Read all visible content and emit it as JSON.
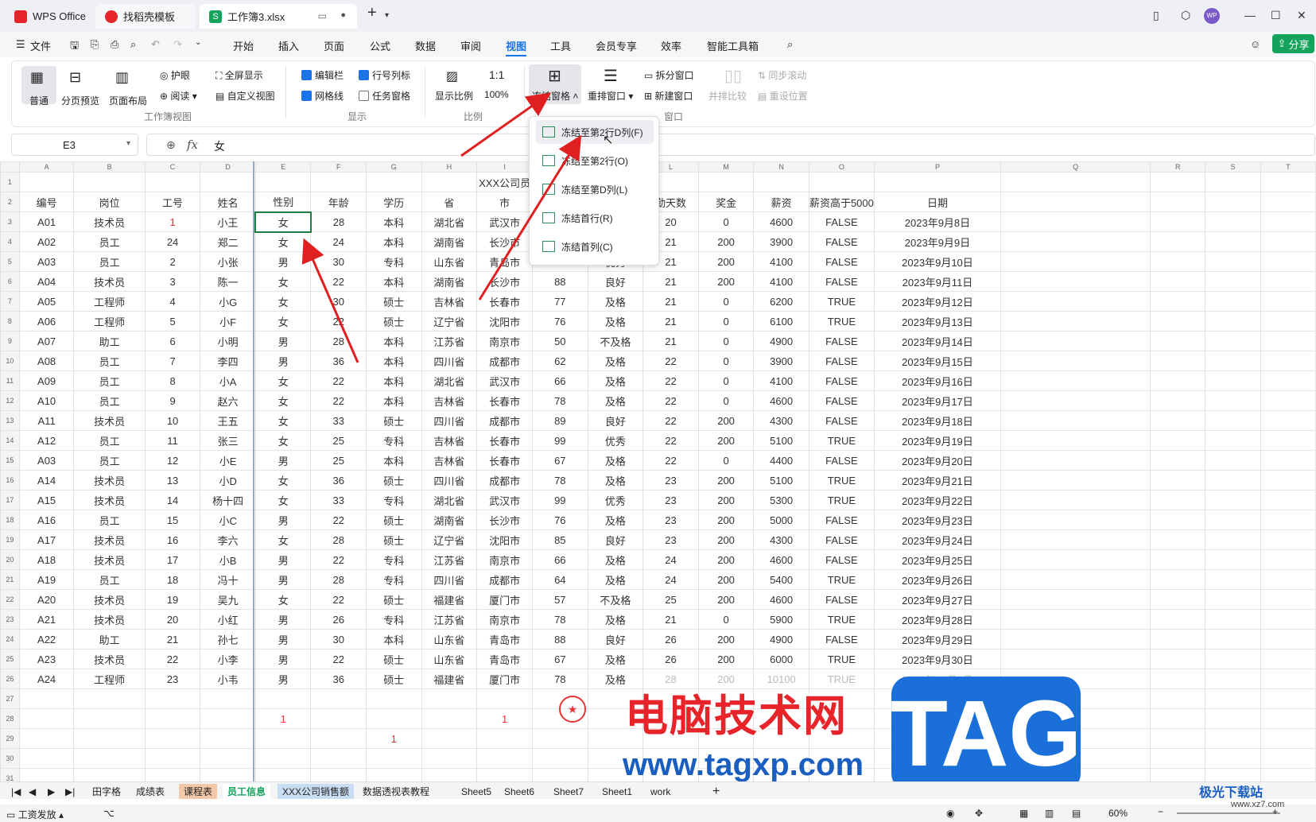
{
  "tabs": [
    {
      "label": "WPS Office"
    },
    {
      "label": "找稻壳模板"
    },
    {
      "label": "工作簿3.xlsx"
    }
  ],
  "menu": {
    "file": "文件",
    "items": [
      "开始",
      "插入",
      "页面",
      "公式",
      "数据",
      "审阅",
      "视图",
      "工具",
      "会员专享",
      "效率",
      "智能工具箱"
    ],
    "active": "视图",
    "share": "分享"
  },
  "ribbon": {
    "normal": "普通",
    "page_break": "分页预览",
    "page_layout": "页面布局",
    "eye": "护眼",
    "read": "阅读",
    "fullscreen": "全屏显示",
    "custom_view": "自定义视图",
    "edit_bar": "编辑栏",
    "row_col": "行号列标",
    "gridlines": "网格线",
    "task_pane": "任务窗格",
    "zoom_ratio": "显示比例",
    "zoom100": "100%",
    "freeze": "冻结窗格",
    "rearrange": "重排窗口",
    "split": "拆分窗口",
    "new_window": "新建窗口",
    "side_by_side": "并排比较",
    "sync_scroll": "同步滚动",
    "reset_pos": "重设位置",
    "grp_view": "工作簿视图",
    "grp_show": "显示",
    "grp_ratio": "比例",
    "grp_window": "窗口"
  },
  "checkboxes": {
    "edit_bar": true,
    "row_col": true,
    "gridlines": true,
    "task_pane": false
  },
  "namebox": "E3",
  "formula": "女",
  "freeze_menu": [
    "冻结至第2行D列(F)",
    "冻结至第2行(O)",
    "冻结至第D列(L)",
    "冻结首行(R)",
    "冻结首列(C)"
  ],
  "sheet": {
    "title": "XXX公司员",
    "col_letters": [
      "A",
      "B",
      "C",
      "D",
      "E",
      "F",
      "G",
      "H",
      "I",
      "J",
      "K",
      "L",
      "M",
      "N",
      "O",
      "P",
      "Q",
      "R",
      "S",
      "T"
    ],
    "headers": [
      "编号",
      "岗位",
      "工号",
      "姓名",
      "性别",
      "年龄",
      "学历",
      "省",
      "市",
      "",
      "",
      "勤天数",
      "奖金",
      "薪资",
      "薪资高于5000",
      "日期"
    ],
    "rows": [
      [
        "A01",
        "技术员",
        "1",
        "小王",
        "女",
        "28",
        "本科",
        "湖北省",
        "武汉市",
        "",
        "",
        "20",
        "0",
        "4600",
        "FALSE",
        "2023年9月8日"
      ],
      [
        "A02",
        "员工",
        "24",
        "郑二",
        "女",
        "24",
        "本科",
        "湖南省",
        "长沙市",
        "",
        "",
        "21",
        "200",
        "3900",
        "FALSE",
        "2023年9月9日"
      ],
      [
        "A03",
        "员工",
        "2",
        "小张",
        "男",
        "30",
        "专科",
        "山东省",
        "青岛市",
        "90",
        "优秀",
        "21",
        "200",
        "4100",
        "FALSE",
        "2023年9月10日"
      ],
      [
        "A04",
        "技术员",
        "3",
        "陈一",
        "女",
        "22",
        "本科",
        "湖南省",
        "长沙市",
        "88",
        "良好",
        "21",
        "200",
        "4100",
        "FALSE",
        "2023年9月11日"
      ],
      [
        "A05",
        "工程师",
        "4",
        "小G",
        "女",
        "30",
        "硕士",
        "吉林省",
        "长春市",
        "77",
        "及格",
        "21",
        "0",
        "6200",
        "TRUE",
        "2023年9月12日"
      ],
      [
        "A06",
        "工程师",
        "5",
        "小F",
        "女",
        "22",
        "硕士",
        "辽宁省",
        "沈阳市",
        "76",
        "及格",
        "21",
        "0",
        "6100",
        "TRUE",
        "2023年9月13日"
      ],
      [
        "A07",
        "助工",
        "6",
        "小明",
        "男",
        "28",
        "本科",
        "江苏省",
        "南京市",
        "50",
        "不及格",
        "21",
        "0",
        "4900",
        "FALSE",
        "2023年9月14日"
      ],
      [
        "A08",
        "员工",
        "7",
        "李四",
        "男",
        "36",
        "本科",
        "四川省",
        "成都市",
        "62",
        "及格",
        "22",
        "0",
        "3900",
        "FALSE",
        "2023年9月15日"
      ],
      [
        "A09",
        "员工",
        "8",
        "小A",
        "女",
        "22",
        "本科",
        "湖北省",
        "武汉市",
        "66",
        "及格",
        "22",
        "0",
        "4100",
        "FALSE",
        "2023年9月16日"
      ],
      [
        "A10",
        "员工",
        "9",
        "赵六",
        "女",
        "22",
        "本科",
        "吉林省",
        "长春市",
        "78",
        "及格",
        "22",
        "0",
        "4600",
        "FALSE",
        "2023年9月17日"
      ],
      [
        "A11",
        "技术员",
        "10",
        "王五",
        "女",
        "33",
        "硕士",
        "四川省",
        "成都市",
        "89",
        "良好",
        "22",
        "200",
        "4300",
        "FALSE",
        "2023年9月18日"
      ],
      [
        "A12",
        "员工",
        "11",
        "张三",
        "女",
        "25",
        "专科",
        "吉林省",
        "长春市",
        "99",
        "优秀",
        "22",
        "200",
        "5100",
        "TRUE",
        "2023年9月19日"
      ],
      [
        "A03",
        "员工",
        "12",
        "小E",
        "男",
        "25",
        "本科",
        "吉林省",
        "长春市",
        "67",
        "及格",
        "22",
        "0",
        "4400",
        "FALSE",
        "2023年9月20日"
      ],
      [
        "A14",
        "技术员",
        "13",
        "小D",
        "女",
        "36",
        "硕士",
        "四川省",
        "成都市",
        "78",
        "及格",
        "23",
        "200",
        "5100",
        "TRUE",
        "2023年9月21日"
      ],
      [
        "A15",
        "技术员",
        "14",
        "杨十四",
        "女",
        "33",
        "专科",
        "湖北省",
        "武汉市",
        "99",
        "优秀",
        "23",
        "200",
        "5300",
        "TRUE",
        "2023年9月22日"
      ],
      [
        "A16",
        "员工",
        "15",
        "小C",
        "男",
        "22",
        "硕士",
        "湖南省",
        "长沙市",
        "76",
        "及格",
        "23",
        "200",
        "5000",
        "FALSE",
        "2023年9月23日"
      ],
      [
        "A17",
        "技术员",
        "16",
        "李六",
        "女",
        "28",
        "硕士",
        "辽宁省",
        "沈阳市",
        "85",
        "良好",
        "23",
        "200",
        "4300",
        "FALSE",
        "2023年9月24日"
      ],
      [
        "A18",
        "技术员",
        "17",
        "小B",
        "男",
        "22",
        "专科",
        "江苏省",
        "南京市",
        "66",
        "及格",
        "24",
        "200",
        "4600",
        "FALSE",
        "2023年9月25日"
      ],
      [
        "A19",
        "员工",
        "18",
        "冯十",
        "男",
        "28",
        "专科",
        "四川省",
        "成都市",
        "64",
        "及格",
        "24",
        "200",
        "5400",
        "TRUE",
        "2023年9月26日"
      ],
      [
        "A20",
        "技术员",
        "19",
        "吴九",
        "女",
        "22",
        "硕士",
        "福建省",
        "厦门市",
        "57",
        "不及格",
        "25",
        "200",
        "4600",
        "FALSE",
        "2023年9月27日"
      ],
      [
        "A21",
        "技术员",
        "20",
        "小红",
        "男",
        "26",
        "专科",
        "江苏省",
        "南京市",
        "78",
        "及格",
        "21",
        "0",
        "5900",
        "TRUE",
        "2023年9月28日"
      ],
      [
        "A22",
        "助工",
        "21",
        "孙七",
        "男",
        "30",
        "本科",
        "山东省",
        "青岛市",
        "88",
        "良好",
        "26",
        "200",
        "4900",
        "FALSE",
        "2023年9月29日"
      ],
      [
        "A23",
        "技术员",
        "22",
        "小李",
        "男",
        "22",
        "硕士",
        "山东省",
        "青岛市",
        "67",
        "及格",
        "26",
        "200",
        "6000",
        "TRUE",
        "2023年9月30日"
      ],
      [
        "A24",
        "工程师",
        "23",
        "小韦",
        "男",
        "36",
        "硕士",
        "福建省",
        "厦门市",
        "78",
        "及格",
        "28",
        "200",
        "10100",
        "TRUE",
        "2023年10月1日"
      ]
    ],
    "extra": {
      "r28_e": "1",
      "r28_i": "1",
      "r29_g": "1"
    }
  },
  "sheet_tabs": [
    "田字格",
    "成绩表",
    "课程表",
    "员工信息",
    "XXX公司销售额",
    "数据透视表教程",
    "Sheet5",
    "Sheet6",
    "Sheet7",
    "Sheet1",
    "work"
  ],
  "active_sheet": "员工信息",
  "status": {
    "left": "工资发放",
    "zoom": "60%"
  },
  "watermark": {
    "cn": "电脑技术网",
    "url": "www.tagxp.com",
    "tag": "TAG",
    "site": "极光下载站",
    "site_url": "www.xz7.com"
  },
  "colors": {
    "accent": "#1a73e8",
    "wps_red": "#e8242b",
    "green": "#14a35c",
    "arrow": "#e02020"
  }
}
